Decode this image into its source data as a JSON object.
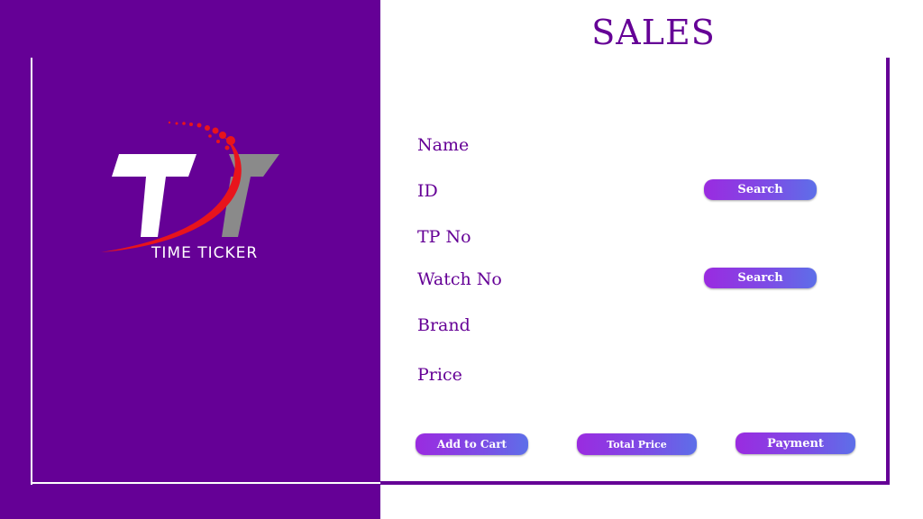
{
  "header": {
    "title": "SALES"
  },
  "logo": {
    "text": "TIME TICKER",
    "letters": "TT"
  },
  "form": {
    "fields": [
      {
        "label": "Name"
      },
      {
        "label": "ID"
      },
      {
        "label": "TP No"
      },
      {
        "label": "Watch No"
      },
      {
        "label": "Brand"
      },
      {
        "label": "Price"
      }
    ],
    "id_search_label": "Search",
    "watch_search_label": "Search"
  },
  "actions": {
    "add_to_cart": "Add to Cart",
    "total_price": "Total Price",
    "payment": "Payment"
  },
  "colors": {
    "brand_purple": "#650096",
    "button_gradient_start": "#9a2be0",
    "button_gradient_end": "#5d6fe8",
    "logo_red": "#e8141c",
    "logo_gray": "#8a8a8a"
  }
}
